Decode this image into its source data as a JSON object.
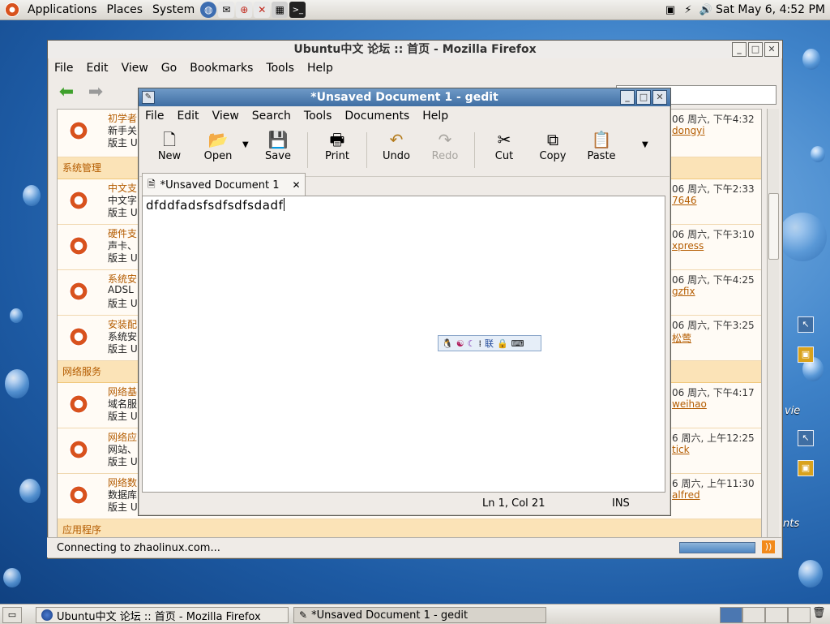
{
  "top_panel": {
    "menus": [
      "Applications",
      "Places",
      "System"
    ],
    "clock": "Sat May  6,  4:52 PM"
  },
  "firefox": {
    "title": "Ubuntu中文 论坛 :: 首页 - Mozilla Firefox",
    "menu": [
      "File",
      "Edit",
      "View",
      "Go",
      "Bookmarks",
      "Tools",
      "Help"
    ],
    "status": "Connecting to zhaolinux.com...",
    "forum": {
      "sections": [
        {
          "heading": "系统管理",
          "rows": [
            {
              "t1": "中文支",
              "t2": "中文字",
              "t3": "版主 U",
              "time": "06 周六, 下午2:33",
              "user": "7646"
            },
            {
              "t1": "硬件支",
              "t2": "声卡、",
              "t3": "版主 U",
              "time": "06 周六, 下午3:10",
              "user": "xpress"
            },
            {
              "t1": "系统安",
              "t2": "ADSL",
              "t3": "版主 U",
              "time": "06 周六, 下午4:25",
              "user": "gzfix"
            },
            {
              "t1": "安装配",
              "t2": "系统安",
              "t3": "版主 U",
              "time": "06 周六, 下午3:25",
              "user": "松莺"
            }
          ]
        },
        {
          "heading": "网络服务",
          "rows": [
            {
              "t1": "网络基",
              "t2": "域名服",
              "t3": "版主 U",
              "time": "06 周六, 下午4:17",
              "user": "weihao"
            },
            {
              "t1": "网络应",
              "t2": "网站、",
              "t3": "版主 U",
              "time": "6 周六, 上午12:25",
              "user": "tick"
            },
            {
              "t1": "网络数",
              "t2": "数据库",
              "t3": "版主 U",
              "time": "6 周六, 上午11:30",
              "user": "alfred"
            }
          ]
        },
        {
          "heading": "应用程序",
          "rows": []
        }
      ],
      "top_row": {
        "t1": "初学者",
        "t2": "新手关",
        "t3": "版主 U",
        "time": "06 周六, 下午4:32",
        "user": "dongyi"
      }
    }
  },
  "gedit": {
    "title": "*Unsaved Document 1 - gedit",
    "menu": [
      "File",
      "Edit",
      "View",
      "Search",
      "Tools",
      "Documents",
      "Help"
    ],
    "toolbar": {
      "new": "New",
      "open": "Open",
      "save": "Save",
      "print": "Print",
      "undo": "Undo",
      "redo": "Redo",
      "cut": "Cut",
      "copy": "Copy",
      "paste": "Paste"
    },
    "tab": "*Unsaved Document 1",
    "text": "dfddfadsfsdfsdfsdadf",
    "status_pos": "Ln 1, Col 21",
    "status_mode": "INS"
  },
  "ime": {
    "label": "联"
  },
  "taskbar": {
    "tasks": [
      "Ubuntu中文 论坛 :: 首页 - Mozilla Firefox",
      "*Unsaved Document 1 - gedit"
    ]
  },
  "desktop": {
    "labels": [
      "vie",
      "nts"
    ]
  }
}
